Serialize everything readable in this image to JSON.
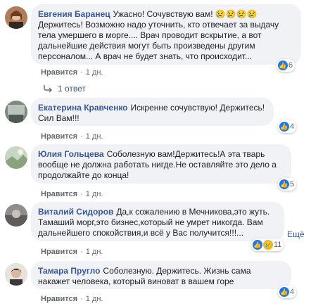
{
  "comments": [
    {
      "author": "Евгения Баранец",
      "text": "Ужасно! Сочувствую вам! 😢😢😢😢 Держитесь! Возможно надо уточнить, кто отвечает за выдачу тела умершего в морге.... Врач проводит вскрытие, а вот дальнейшие действия могут быть произведены другим персоналом... А врач не будет знать, что происходит...",
      "reaction_count": "6",
      "like_label": "Нравится",
      "time": "1 дн.",
      "replies_label": "1 ответ"
    },
    {
      "author": "Екатерина Кравченко",
      "text": "Искренне сочувствую! Держитесь! Сил Вам!!!",
      "reaction_count": "4",
      "like_label": "Нравится",
      "time": "1 дн."
    },
    {
      "author": "Юлия Гольцева",
      "text": "Соболезную вам!Держитесь!А эта тварь вообще не должна работать нигде.Не оставляйте это дело а продолжайте до конца!",
      "reaction_count": "5",
      "like_label": "Нравится",
      "time": "1 дн."
    },
    {
      "author": "Виталий Сидоров",
      "text": "Да,к сожалению в Мечникова,это жуть. Тамаший морг,это бизнес,который не умрет никогда. Вам дальнейшего спокойствия,и всё у Вас получится!!!...",
      "more_label": "Ещё",
      "reaction_count": "11",
      "like_label": "Нравится",
      "time": "1 дн."
    },
    {
      "author": "Тамара Пругло",
      "text": "Соболезную. Держитесь. Жизнь сама накажет человека, который виноват в вашем горе",
      "reaction_count": "4",
      "like_label": "Нравится",
      "time": "1 дн."
    }
  ],
  "icons": {
    "like": "like-icon",
    "sad": "sad-icon",
    "reply_arrow": "reply-arrow-icon"
  },
  "colors": {
    "author": "#385898",
    "bubble": "#f0f2f5",
    "like_blue": "#1877f2",
    "meta_gray": "#65676b"
  }
}
